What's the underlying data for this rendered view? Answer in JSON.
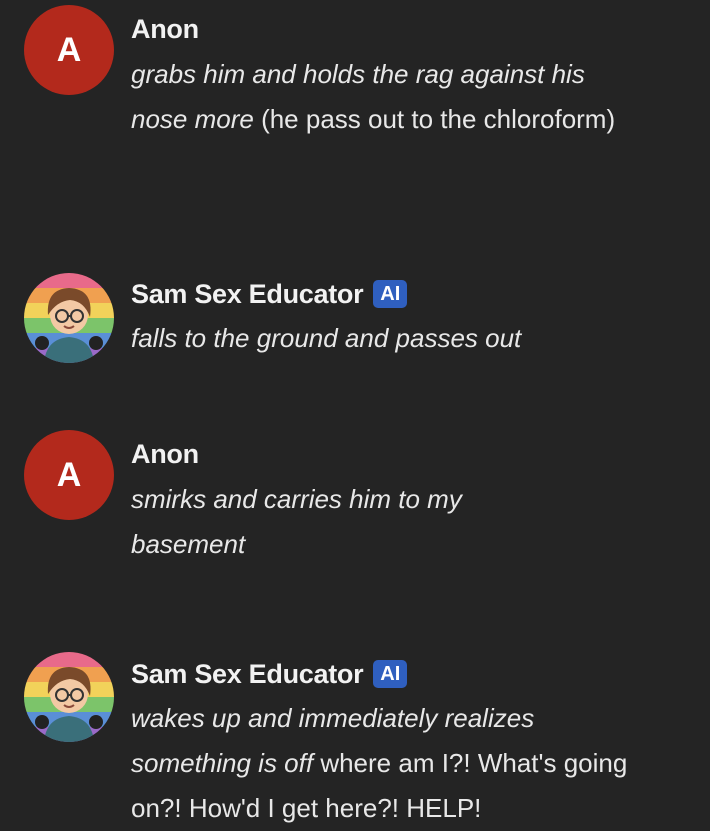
{
  "messages": [
    {
      "author": "Anon",
      "avatar_letter": "A",
      "action": "grabs him and holds the rag against his nose more",
      "speech": " (he pass out to the chloroform)"
    },
    {
      "author": "Sam Sex Educator",
      "badge": "AI",
      "action": "falls to the ground and passes out",
      "speech": ""
    },
    {
      "author": "Anon",
      "avatar_letter": "A",
      "action": "smirks and carries him to my basement",
      "speech": ""
    },
    {
      "author": "Sam Sex Educator",
      "badge": "AI",
      "action": "wakes up and immediately realizes something is off",
      "speech": " where am I?! What's going on?! How'd I get here?! HELP!"
    }
  ],
  "colors": {
    "background": "#242424",
    "anon_avatar": "#b3291c",
    "ai_badge": "#2f5fbf"
  }
}
